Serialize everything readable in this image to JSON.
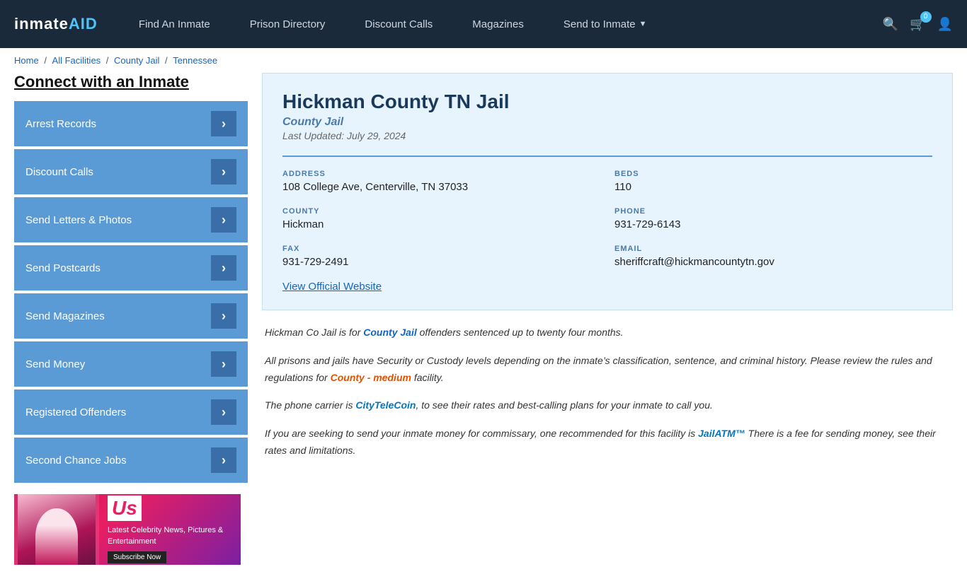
{
  "header": {
    "logo": "inmateAID",
    "logo_colored": "AID",
    "nav": [
      {
        "label": "Find An Inmate",
        "id": "find-inmate"
      },
      {
        "label": "Prison Directory",
        "id": "prison-directory"
      },
      {
        "label": "Discount Calls",
        "id": "discount-calls"
      },
      {
        "label": "Magazines",
        "id": "magazines"
      },
      {
        "label": "Send to Inmate",
        "id": "send-to-inmate",
        "has_caret": true
      }
    ],
    "cart_count": "0"
  },
  "breadcrumb": {
    "home": "Home",
    "all_facilities": "All Facilities",
    "county_jail": "County Jail",
    "state": "Tennessee"
  },
  "sidebar": {
    "title": "Connect with an Inmate",
    "items": [
      {
        "label": "Arrest Records"
      },
      {
        "label": "Discount Calls"
      },
      {
        "label": "Send Letters & Photos"
      },
      {
        "label": "Send Postcards"
      },
      {
        "label": "Send Magazines"
      },
      {
        "label": "Send Money"
      },
      {
        "label": "Registered Offenders"
      },
      {
        "label": "Second Chance Jobs"
      }
    ]
  },
  "facility": {
    "name": "Hickman County TN Jail",
    "type": "County Jail",
    "last_updated": "Last Updated: July 29, 2024",
    "address_label": "ADDRESS",
    "address": "108 College Ave, Centerville, TN 37033",
    "beds_label": "BEDS",
    "beds": "110",
    "county_label": "COUNTY",
    "county": "Hickman",
    "phone_label": "PHONE",
    "phone": "931-729-6143",
    "fax_label": "FAX",
    "fax": "931-729-2491",
    "email_label": "EMAIL",
    "email": "sheriffcraft@hickmancountytn.gov",
    "view_website_label": "View Official Website"
  },
  "description": {
    "para1_pre": "Hickman Co Jail is for ",
    "para1_link": "County Jail",
    "para1_post": " offenders sentenced up to twenty four months.",
    "para2_pre": "All prisons and jails have Security or Custody levels depending on the inmate’s classification, sentence, and criminal history. Please review the rules and regulations for ",
    "para2_link": "County - medium",
    "para2_post": " facility.",
    "para3_pre": "The phone carrier is ",
    "para3_link": "CityTeleCoin",
    "para3_post": ", to see their rates and best-calling plans for your inmate to call you.",
    "para4_pre": "If you are seeking to send your inmate money for commissary, one recommended for this facility is ",
    "para4_link": "JailATM™",
    "para4_post": " There is a fee for sending money, see their rates and limitations."
  },
  "ad": {
    "logo": "Us",
    "text": "Latest Celebrity News, Pictures & Entertainment",
    "btn": "Subscribe Now"
  }
}
